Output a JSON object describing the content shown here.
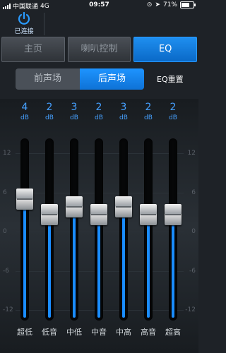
{
  "status": {
    "carrier": "中国联通",
    "network": "4G",
    "time": "09:57",
    "battery": "71%",
    "battery_level": 0.71
  },
  "header": {
    "power_label": "已连接",
    "accent": "#2a9bff"
  },
  "tabs": [
    {
      "label": "主页",
      "active": false
    },
    {
      "label": "喇叭控制",
      "active": false
    },
    {
      "label": "EQ",
      "active": true
    }
  ],
  "subtabs": [
    {
      "label": "前声场",
      "active": false
    },
    {
      "label": "后声场",
      "active": true
    }
  ],
  "eq_reset_label": "EQ重置",
  "scale": [
    "12",
    "6",
    "0",
    "-6",
    "-12"
  ],
  "bands": [
    {
      "value": "4",
      "unit": "dB",
      "name": "超低",
      "level": 4
    },
    {
      "value": "2",
      "unit": "dB",
      "name": "低音",
      "level": 2
    },
    {
      "value": "3",
      "unit": "dB",
      "name": "中低",
      "level": 3
    },
    {
      "value": "2",
      "unit": "dB",
      "name": "中音",
      "level": 2
    },
    {
      "value": "3",
      "unit": "dB",
      "name": "中高",
      "level": 3
    },
    {
      "value": "2",
      "unit": "dB",
      "name": "高音",
      "level": 2
    },
    {
      "value": "2",
      "unit": "dB",
      "name": "超高",
      "level": 2
    }
  ]
}
